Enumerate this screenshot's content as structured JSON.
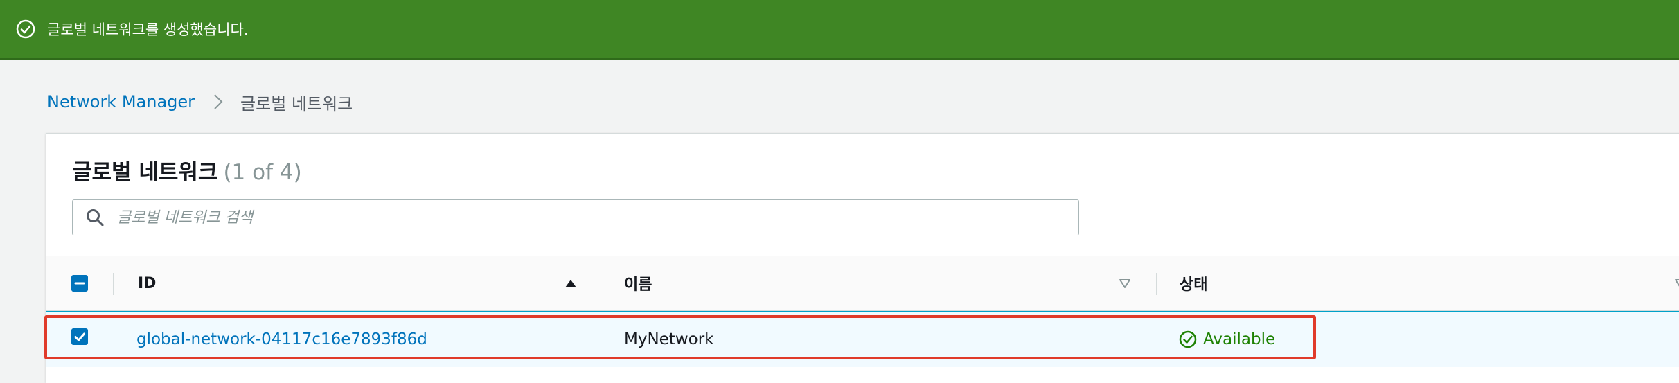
{
  "flash": {
    "message": "글로벌 네트워크를 생성했습니다.",
    "icon": "check-circle-icon",
    "color": "#3f8624"
  },
  "breadcrumb": {
    "parent": "Network Manager",
    "current": "글로벌 네트워크"
  },
  "panel": {
    "title": "글로벌 네트워크",
    "count": "(1 of 4)"
  },
  "search": {
    "placeholder": "글로벌 네트워크 검색",
    "value": ""
  },
  "table": {
    "columns": [
      {
        "label": "ID",
        "sort": "ascending"
      },
      {
        "label": "이름",
        "sort": "none"
      },
      {
        "label": "상태",
        "sort": "none"
      }
    ],
    "select_all_state": "indeterminate",
    "rows": [
      {
        "selected": true,
        "id": "global-network-04117c16e7893f86d",
        "name": "MyNetwork",
        "status": "Available",
        "status_color": "#1d8102"
      }
    ]
  },
  "accent_color": "#0073bb",
  "highlight_color": "#e03a2a"
}
